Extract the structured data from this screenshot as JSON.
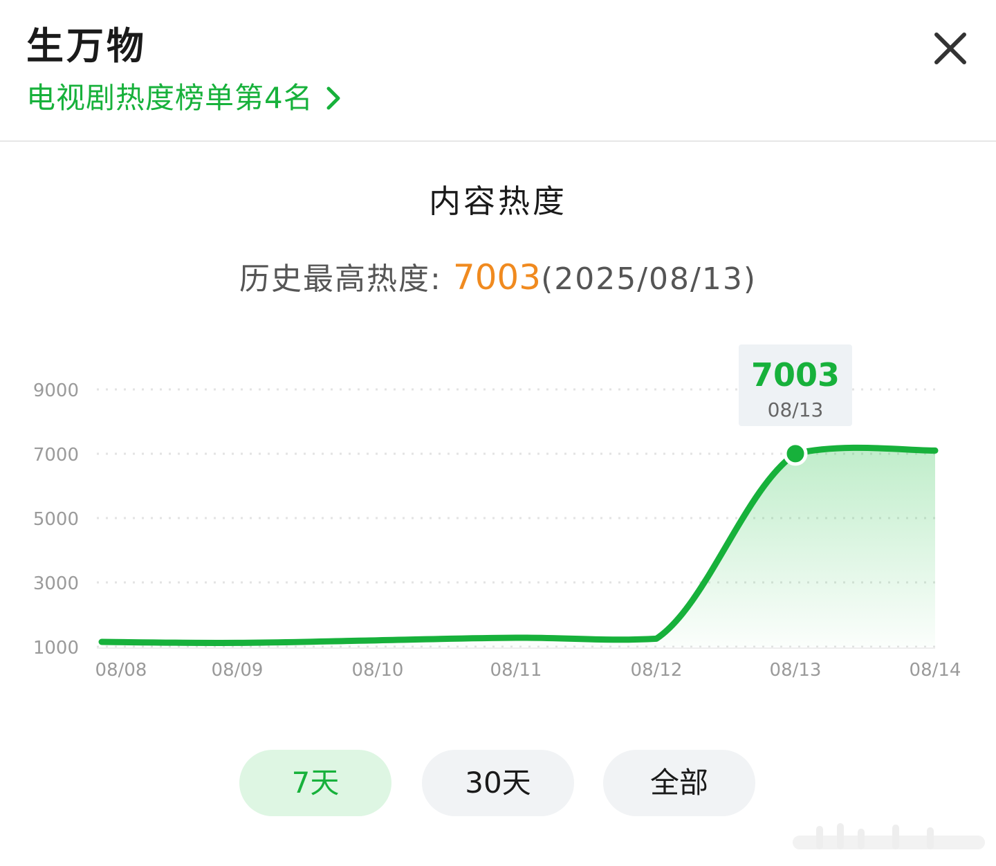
{
  "header": {
    "title": "生万物",
    "rank_text": "电视剧热度榜单第4名"
  },
  "icons": {
    "close": "close-icon",
    "chevron": "chevron-right-icon"
  },
  "content": {
    "section_title": "内容热度",
    "peak_label": "历史最高热度:",
    "peak_value": "7003",
    "peak_date": "(2025/08/13)"
  },
  "colors": {
    "accent_green": "#17b13b",
    "peak_orange": "#f08a1f",
    "active_tab_bg": "#def6e3",
    "tab_bg": "#f1f3f5"
  },
  "chart_data": {
    "type": "area",
    "title": "",
    "xlabel": "",
    "ylabel": "",
    "categories": [
      "08/08",
      "08/09",
      "08/10",
      "08/11",
      "08/12",
      "08/13",
      "08/14"
    ],
    "series": [
      {
        "values": [
          1150,
          1120,
          1200,
          1280,
          1250,
          7003,
          7100
        ]
      }
    ],
    "y_ticks": [
      9000,
      7000,
      5000,
      3000,
      1000
    ],
    "ylim": [
      1000,
      9000
    ],
    "grid": true,
    "tooltip": {
      "value": "7003",
      "label": "08/13"
    }
  },
  "range_tabs": [
    {
      "label": "7天",
      "active": true
    },
    {
      "label": "30天",
      "active": false
    },
    {
      "label": "全部",
      "active": false
    }
  ]
}
